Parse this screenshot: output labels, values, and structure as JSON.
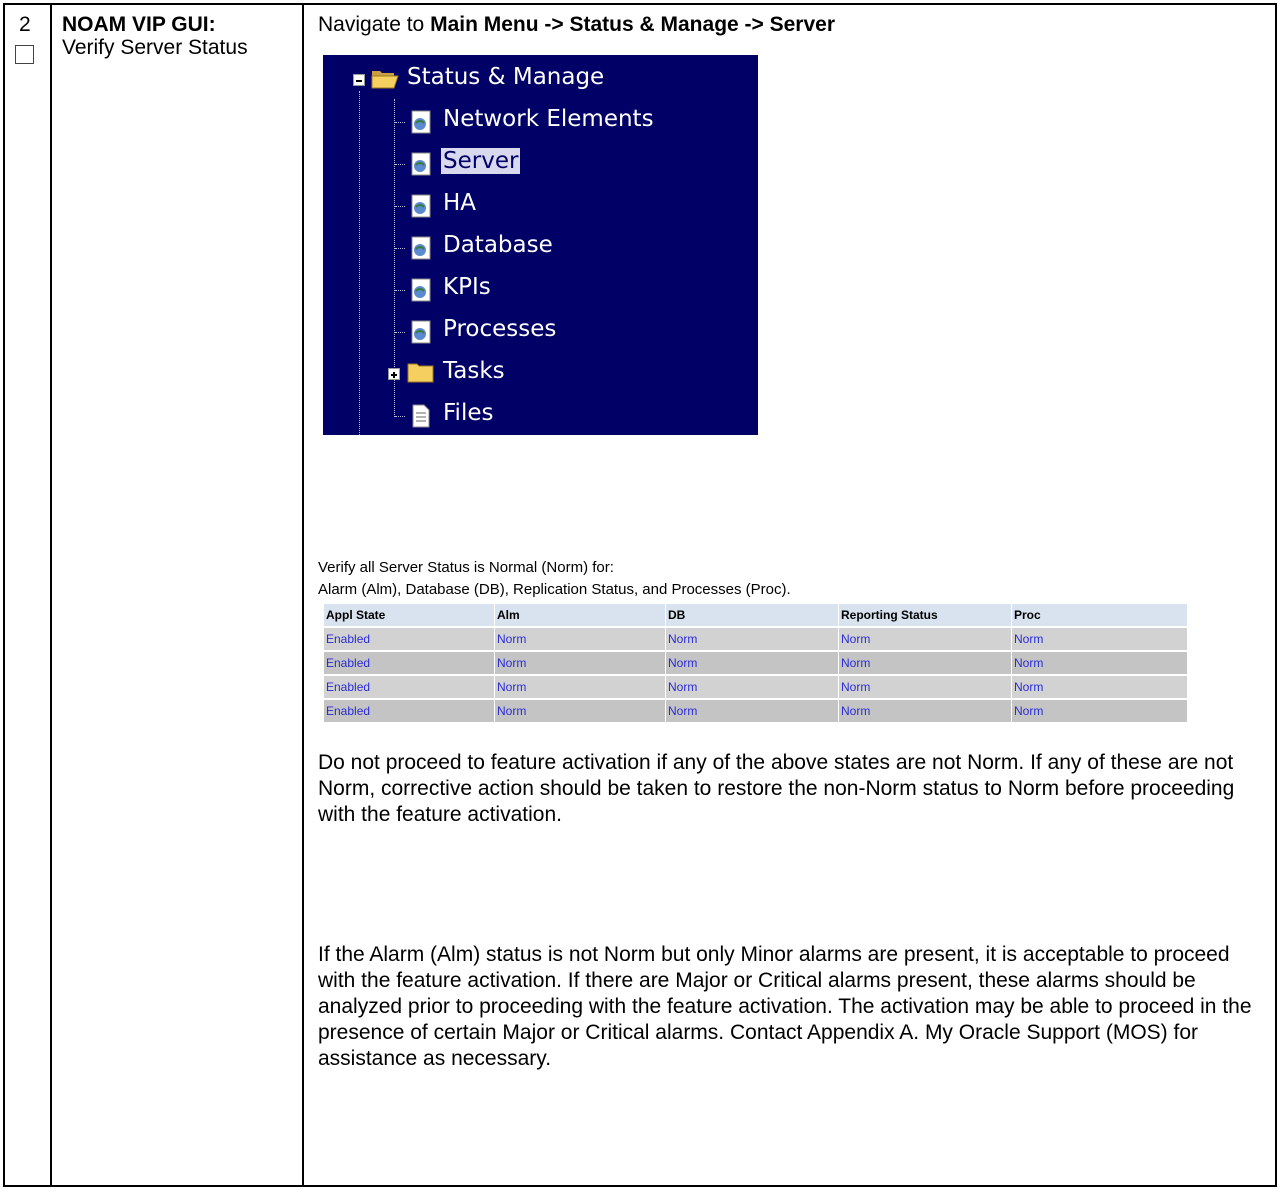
{
  "step": {
    "number": "2",
    "title_bold": "NOAM VIP GUI:",
    "title_rest": "Verify Server Status"
  },
  "nav": {
    "prefix": "Navigate to ",
    "path": "Main Menu -> Status & Manage -> Server"
  },
  "menu": {
    "root": "Status & Manage",
    "items": [
      "Network Elements",
      "Server",
      "HA",
      "Database",
      "KPIs",
      "Processes",
      "Tasks",
      "Files"
    ],
    "selected": "Server",
    "colors": {
      "background": "#000066",
      "text": "#ffffff",
      "selected_bg": "#d8d8ee"
    }
  },
  "verify": {
    "line1": "Verify all Server Status is Normal (Norm) for:",
    "line2": "Alarm (Alm),  Database (DB), Replication Status, and Processes (Proc)."
  },
  "status_table": {
    "headers": [
      "Appl State",
      "Alm",
      "DB",
      "Reporting Status",
      "Proc"
    ],
    "rows": [
      [
        "Enabled",
        "Norm",
        "Norm",
        "Norm",
        "Norm"
      ],
      [
        "Enabled",
        "Norm",
        "Norm",
        "Norm",
        "Norm"
      ],
      [
        "Enabled",
        "Norm",
        "Norm",
        "Norm",
        "Norm"
      ],
      [
        "Enabled",
        "Norm",
        "Norm",
        "Norm",
        "Norm"
      ]
    ]
  },
  "paragraphs": {
    "p1": "Do not proceed to feature activation if any of the above states are not Norm. If any of these are not Norm, corrective action should be taken to restore the non-Norm status to Norm before proceeding with the feature activation.",
    "p2": "If the Alarm (Alm) status is not Norm but only Minor alarms are present, it is acceptable to proceed with the feature activation.  If there are Major or Critical alarms present, these alarms should be analyzed prior to proceeding with the feature activation.  The activation may be able to proceed in the presence of certain Major or Critical alarms.  Contact Appendix A. My Oracle Support (MOS) for assistance as necessary."
  }
}
